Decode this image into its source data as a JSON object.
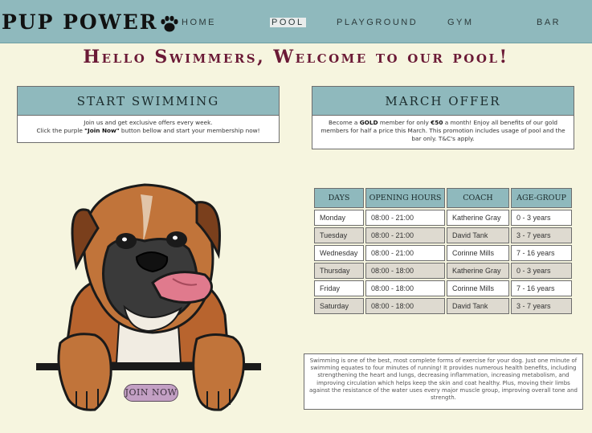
{
  "brand": {
    "name": "PUP POWER",
    "logo_icon": "paw-icon"
  },
  "nav": {
    "items": [
      {
        "label": "HOME",
        "active": false
      },
      {
        "label": "POOL",
        "active": true
      },
      {
        "label": "PLAYGROUND",
        "active": false
      },
      {
        "label": "GYM",
        "active": false
      },
      {
        "label": "BAR",
        "active": false
      }
    ]
  },
  "hero": {
    "title": "Hello Swimmers, Welcome to our pool!"
  },
  "start_box": {
    "title": "START SWIMMING",
    "line1": "Join us and get exclusive offers every week.",
    "line2_pre": "Click the purple ",
    "line2_strong": "\"Join Now\"",
    "line2_post": " button bellow and start your membership now!"
  },
  "offer_box": {
    "title": "MARCH OFFER",
    "text_pre": "Become a ",
    "text_strong1": "GOLD",
    "text_mid": " member for only ",
    "text_strong2": "€50",
    "text_post": " a month! Enjoy all benefits of our gold members for half a price this March. This promotion includes usage of pool and the bar only. T&C's apply."
  },
  "schedule": {
    "headers": [
      "DAYS",
      "OPENING HOURS",
      "COACH",
      "AGE-GROUP"
    ],
    "rows": [
      [
        "Monday",
        "08:00 - 21:00",
        "Katherine Gray",
        "0 - 3 years"
      ],
      [
        "Tuesday",
        "08:00 - 21:00",
        "David Tank",
        "3 - 7 years"
      ],
      [
        "Wednesday",
        "08:00 - 21:00",
        "Corinne Mills",
        "7 - 16 years"
      ],
      [
        "Thursday",
        "08:00 - 18:00",
        "Katherine Gray",
        "0 - 3 years"
      ],
      [
        "Friday",
        "08:00 - 18:00",
        "Corinne Mills",
        "7 - 16 years"
      ],
      [
        "Saturday",
        "08:00 - 18:00",
        "David Tank",
        "3 - 7 years"
      ]
    ]
  },
  "description": "Swimming is one of the best, most complete forms of exercise for your dog. Just one minute of swimming equates to four minutes of running! It provides numerous health benefits, including strengthening the heart and lungs, decreasing inflammation, increasing metabolism, and improving circulation which helps keep the skin and coat healthy. Plus, moving their limbs against the resistance of the water uses every major muscle group, improving overall tone and strength.",
  "join_button": {
    "label": "JOIN NOW",
    "color": "#c3a0c4"
  },
  "colors": {
    "header": "#8fb9bd",
    "background": "#f6f5df",
    "title": "#6b1a36",
    "row_alt": "#dedad0"
  }
}
